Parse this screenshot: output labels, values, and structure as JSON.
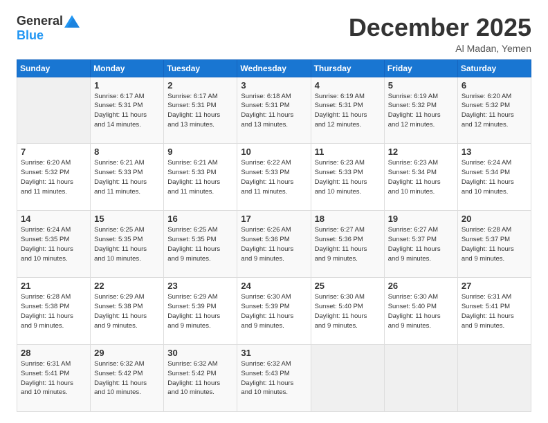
{
  "logo": {
    "general": "General",
    "blue": "Blue"
  },
  "title": "December 2025",
  "location": "Al Madan, Yemen",
  "days_header": [
    "Sunday",
    "Monday",
    "Tuesday",
    "Wednesday",
    "Thursday",
    "Friday",
    "Saturday"
  ],
  "weeks": [
    [
      {
        "day": "",
        "sunrise": "",
        "sunset": "",
        "daylight": ""
      },
      {
        "day": "1",
        "sunrise": "6:17 AM",
        "sunset": "5:31 PM",
        "daylight": "11 hours and 14 minutes."
      },
      {
        "day": "2",
        "sunrise": "6:17 AM",
        "sunset": "5:31 PM",
        "daylight": "11 hours and 13 minutes."
      },
      {
        "day": "3",
        "sunrise": "6:18 AM",
        "sunset": "5:31 PM",
        "daylight": "11 hours and 13 minutes."
      },
      {
        "day": "4",
        "sunrise": "6:19 AM",
        "sunset": "5:31 PM",
        "daylight": "11 hours and 12 minutes."
      },
      {
        "day": "5",
        "sunrise": "6:19 AM",
        "sunset": "5:32 PM",
        "daylight": "11 hours and 12 minutes."
      },
      {
        "day": "6",
        "sunrise": "6:20 AM",
        "sunset": "5:32 PM",
        "daylight": "11 hours and 12 minutes."
      }
    ],
    [
      {
        "day": "7",
        "sunrise": "6:20 AM",
        "sunset": "5:32 PM",
        "daylight": "11 hours and 11 minutes."
      },
      {
        "day": "8",
        "sunrise": "6:21 AM",
        "sunset": "5:33 PM",
        "daylight": "11 hours and 11 minutes."
      },
      {
        "day": "9",
        "sunrise": "6:21 AM",
        "sunset": "5:33 PM",
        "daylight": "11 hours and 11 minutes."
      },
      {
        "day": "10",
        "sunrise": "6:22 AM",
        "sunset": "5:33 PM",
        "daylight": "11 hours and 11 minutes."
      },
      {
        "day": "11",
        "sunrise": "6:23 AM",
        "sunset": "5:33 PM",
        "daylight": "11 hours and 10 minutes."
      },
      {
        "day": "12",
        "sunrise": "6:23 AM",
        "sunset": "5:34 PM",
        "daylight": "11 hours and 10 minutes."
      },
      {
        "day": "13",
        "sunrise": "6:24 AM",
        "sunset": "5:34 PM",
        "daylight": "11 hours and 10 minutes."
      }
    ],
    [
      {
        "day": "14",
        "sunrise": "6:24 AM",
        "sunset": "5:35 PM",
        "daylight": "11 hours and 10 minutes."
      },
      {
        "day": "15",
        "sunrise": "6:25 AM",
        "sunset": "5:35 PM",
        "daylight": "11 hours and 10 minutes."
      },
      {
        "day": "16",
        "sunrise": "6:25 AM",
        "sunset": "5:35 PM",
        "daylight": "11 hours and 9 minutes."
      },
      {
        "day": "17",
        "sunrise": "6:26 AM",
        "sunset": "5:36 PM",
        "daylight": "11 hours and 9 minutes."
      },
      {
        "day": "18",
        "sunrise": "6:27 AM",
        "sunset": "5:36 PM",
        "daylight": "11 hours and 9 minutes."
      },
      {
        "day": "19",
        "sunrise": "6:27 AM",
        "sunset": "5:37 PM",
        "daylight": "11 hours and 9 minutes."
      },
      {
        "day": "20",
        "sunrise": "6:28 AM",
        "sunset": "5:37 PM",
        "daylight": "11 hours and 9 minutes."
      }
    ],
    [
      {
        "day": "21",
        "sunrise": "6:28 AM",
        "sunset": "5:38 PM",
        "daylight": "11 hours and 9 minutes."
      },
      {
        "day": "22",
        "sunrise": "6:29 AM",
        "sunset": "5:38 PM",
        "daylight": "11 hours and 9 minutes."
      },
      {
        "day": "23",
        "sunrise": "6:29 AM",
        "sunset": "5:39 PM",
        "daylight": "11 hours and 9 minutes."
      },
      {
        "day": "24",
        "sunrise": "6:30 AM",
        "sunset": "5:39 PM",
        "daylight": "11 hours and 9 minutes."
      },
      {
        "day": "25",
        "sunrise": "6:30 AM",
        "sunset": "5:40 PM",
        "daylight": "11 hours and 9 minutes."
      },
      {
        "day": "26",
        "sunrise": "6:30 AM",
        "sunset": "5:40 PM",
        "daylight": "11 hours and 9 minutes."
      },
      {
        "day": "27",
        "sunrise": "6:31 AM",
        "sunset": "5:41 PM",
        "daylight": "11 hours and 9 minutes."
      }
    ],
    [
      {
        "day": "28",
        "sunrise": "6:31 AM",
        "sunset": "5:41 PM",
        "daylight": "11 hours and 10 minutes."
      },
      {
        "day": "29",
        "sunrise": "6:32 AM",
        "sunset": "5:42 PM",
        "daylight": "11 hours and 10 minutes."
      },
      {
        "day": "30",
        "sunrise": "6:32 AM",
        "sunset": "5:42 PM",
        "daylight": "11 hours and 10 minutes."
      },
      {
        "day": "31",
        "sunrise": "6:32 AM",
        "sunset": "5:43 PM",
        "daylight": "11 hours and 10 minutes."
      },
      {
        "day": "",
        "sunrise": "",
        "sunset": "",
        "daylight": ""
      },
      {
        "day": "",
        "sunrise": "",
        "sunset": "",
        "daylight": ""
      },
      {
        "day": "",
        "sunrise": "",
        "sunset": "",
        "daylight": ""
      }
    ]
  ],
  "labels": {
    "sunrise": "Sunrise:",
    "sunset": "Sunset:",
    "daylight": "Daylight:"
  }
}
